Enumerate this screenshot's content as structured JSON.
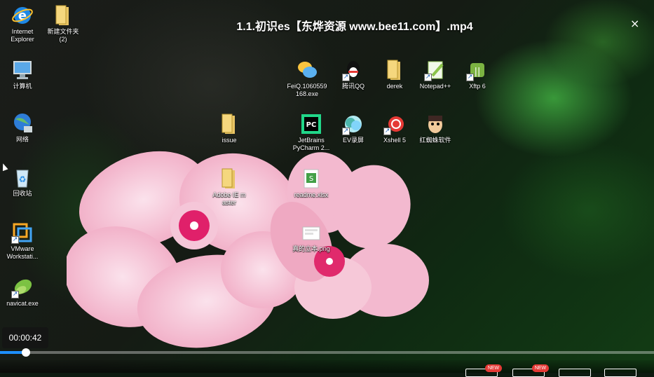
{
  "player": {
    "title": "1.1.初识es【东烨资源 www.bee11.com】.mp4",
    "close_glyph": "×",
    "current_time": "00:00:42",
    "progress": 0.04,
    "new_badge_1": "NEW",
    "new_badge_2": "NEW"
  },
  "desktop": {
    "icons": [
      {
        "label": "Internet\nExplorer",
        "icon": "ie-icon"
      },
      {
        "label": "新建文件夹\n(2)",
        "icon": "folder-icon"
      },
      {
        "label": "计算机",
        "icon": "computer-icon"
      },
      {
        "label": "网络",
        "icon": "network-icon"
      },
      {
        "label": "回收站",
        "icon": "recycle-bin-icon"
      },
      {
        "label": "VMware\nWorkstati...",
        "icon": "vmware-icon"
      },
      {
        "label": "navicat.exe",
        "icon": "navicat-icon"
      },
      {
        "label": "FeiQ.1060559\n168.exe",
        "icon": "feiq-icon"
      },
      {
        "label": "腾讯QQ",
        "icon": "qq-icon"
      },
      {
        "label": "derek",
        "icon": "folder-icon"
      },
      {
        "label": "Notepad++",
        "icon": "notepad-icon"
      },
      {
        "label": "Xftp 6",
        "icon": "xftp-icon"
      },
      {
        "label": "issue",
        "icon": "folder-icon"
      },
      {
        "label": "JetBrains\nPyCharm 2...",
        "icon": "pycharm-icon"
      },
      {
        "label": "EV录屏",
        "icon": "ev-icon"
      },
      {
        "label": "Xshell 5",
        "icon": "xshell-icon"
      },
      {
        "label": "红蜘蛛软件",
        "icon": "spider-icon"
      },
      {
        "label": "Adobe IE m\naster",
        "icon": "folder-icon"
      },
      {
        "label": "readme.xlsx",
        "icon": "xlsx-icon"
      },
      {
        "label": "真的立本.png",
        "icon": "png-icon"
      }
    ]
  },
  "colors": {
    "accent": "#1e90ff",
    "badge": "#e53935"
  }
}
